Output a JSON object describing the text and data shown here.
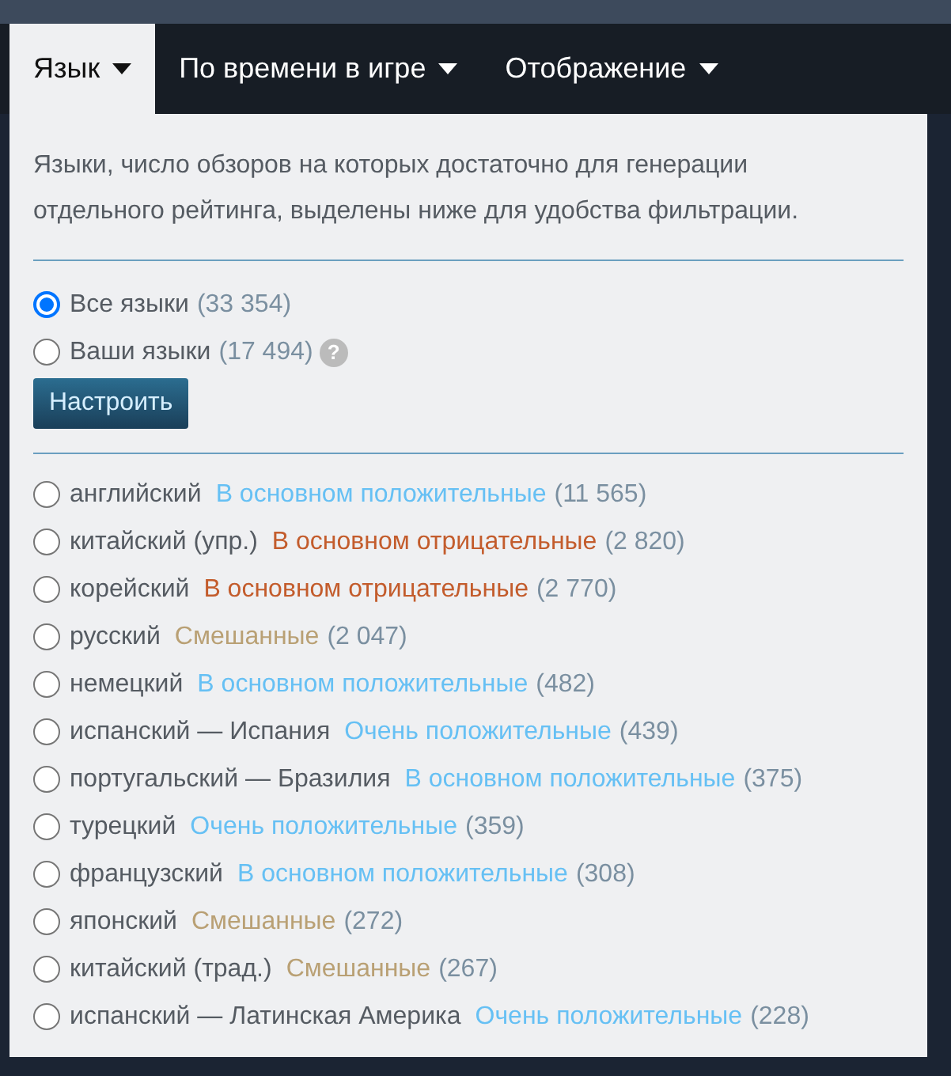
{
  "tabs": [
    {
      "label": "Язык",
      "selected": true
    },
    {
      "label": "По времени в игре",
      "selected": false
    },
    {
      "label": "Отображение",
      "selected": false
    }
  ],
  "description": "Языки, число обзоров на которых достаточно для генерации отдельного рейтинга, выделены ниже для удобства фильтрации.",
  "scope_options": [
    {
      "label": "Все языки",
      "count": "(33 354)",
      "selected": true,
      "help": false
    },
    {
      "label": "Ваши языки",
      "count": "(17 494)",
      "selected": false,
      "help": true
    }
  ],
  "help_icon": "?",
  "customize_button": "Настроить",
  "languages": [
    {
      "name": "английский",
      "rating": "В основном положительные",
      "color": "#66c0f4",
      "count": "(11 565)",
      "selected": false
    },
    {
      "name": "китайский (упр.)",
      "rating": "В основном отрицательные",
      "color": "#c35c2c",
      "count": "(2 820)",
      "selected": false
    },
    {
      "name": "корейский",
      "rating": "В основном отрицательные",
      "color": "#c35c2c",
      "count": "(2 770)",
      "selected": false
    },
    {
      "name": "русский",
      "rating": "Смешанные",
      "color": "#b9a074",
      "count": "(2 047)",
      "selected": false
    },
    {
      "name": "немецкий",
      "rating": "В основном положительные",
      "color": "#66c0f4",
      "count": "(482)",
      "selected": false
    },
    {
      "name": "испанский — Испания",
      "rating": "Очень положительные",
      "color": "#66c0f4",
      "count": "(439)",
      "selected": false
    },
    {
      "name": "португальский — Бразилия",
      "rating": "В основном положительные",
      "color": "#66c0f4",
      "count": "(375)",
      "selected": false
    },
    {
      "name": "турецкий",
      "rating": "Очень положительные",
      "color": "#66c0f4",
      "count": "(359)",
      "selected": false
    },
    {
      "name": "французский",
      "rating": "В основном положительные",
      "color": "#66c0f4",
      "count": "(308)",
      "selected": false
    },
    {
      "name": "японский",
      "rating": "Смешанные",
      "color": "#b9a074",
      "count": "(272)",
      "selected": false
    },
    {
      "name": "китайский (трад.)",
      "rating": "Смешанные",
      "color": "#b9a074",
      "count": "(267)",
      "selected": false
    },
    {
      "name": "испанский — Латинская Америка",
      "rating": "Очень положительные",
      "color": "#66c0f4",
      "count": "(228)",
      "selected": false
    }
  ]
}
